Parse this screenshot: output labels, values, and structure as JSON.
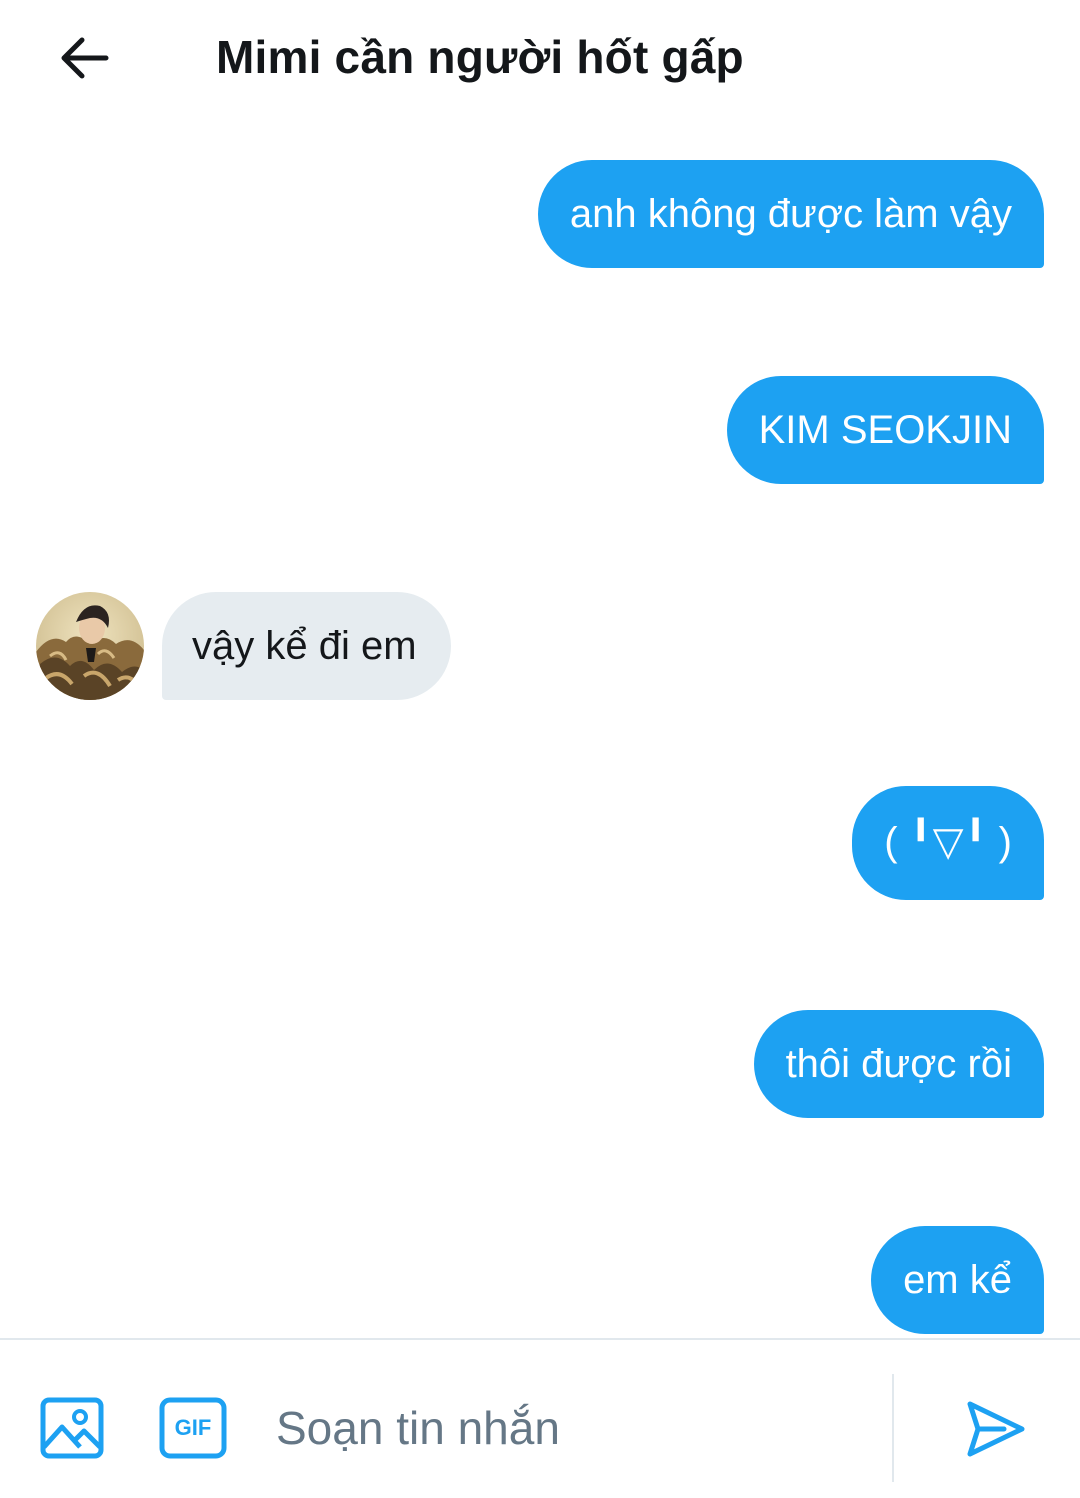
{
  "header": {
    "title": "Mimi cần người hốt gấp",
    "back_icon": "arrow-left-icon"
  },
  "messages": [
    {
      "direction": "sent",
      "text": "anh không được làm vậy"
    },
    {
      "direction": "sent",
      "text": "KIM SEOKJIN"
    },
    {
      "direction": "received",
      "text": "vậy kể đi em"
    },
    {
      "direction": "sent",
      "text": "( ╹▽╹ )"
    },
    {
      "direction": "sent",
      "text": "thôi được rồi"
    },
    {
      "direction": "sent",
      "text": "em kể"
    }
  ],
  "composer": {
    "placeholder": "Soạn tin nhắn",
    "image_icon": "image-icon",
    "gif_label": "GIF",
    "send_icon": "send-icon"
  },
  "colors": {
    "accent": "#1da1f2",
    "received_bubble": "#e6ecf0",
    "text_dark": "#14171a",
    "placeholder": "#657786"
  }
}
